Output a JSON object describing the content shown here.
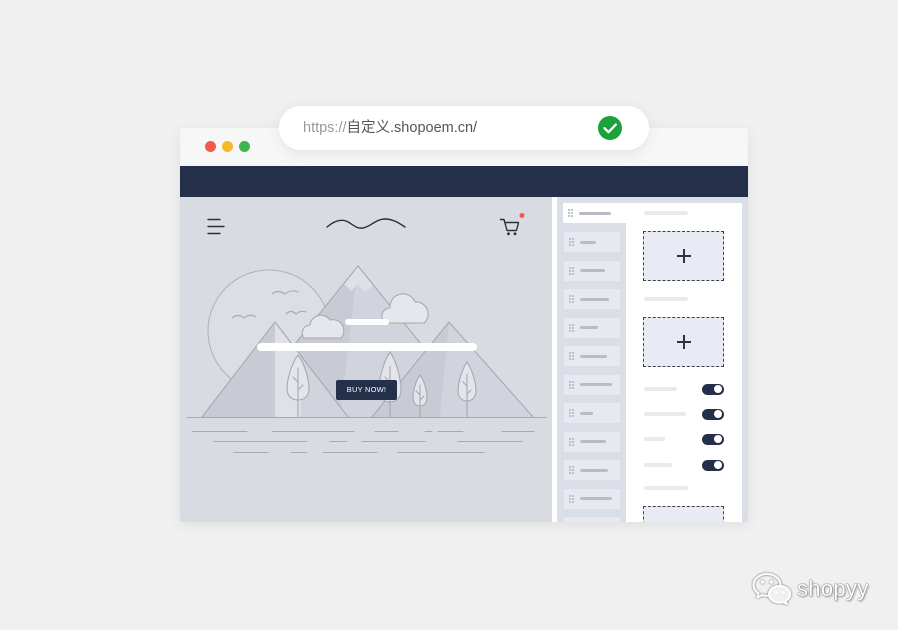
{
  "colors": {
    "page_background": "#f0f0f0",
    "navy": "#243049",
    "success_green": "#1ba23b",
    "close_dot": "#f25a4a",
    "minimize_dot": "#f6b92d",
    "maximize_dot": "#3cb64c",
    "notification_red": "#f25a4a"
  },
  "browser": {
    "window_controls": [
      "close-dot-icon",
      "minimize-dot-icon",
      "maximize-dot-icon"
    ],
    "address_bar": {
      "protocol": "https://",
      "domain": "自定义.shopoem.cn/",
      "status_icon": "check-circle-icon"
    }
  },
  "storefront": {
    "menu_icon": "hamburger-menu-icon",
    "logo_icon": "wave-logo-icon",
    "cart_icon": "shopping-cart-icon",
    "cart_has_notification": true,
    "cta_label": "BUY NOW!"
  },
  "editor": {
    "add_block_icon": "plus-icon",
    "drag_icon": "drag-handle-icon",
    "toggles": [
      true,
      true,
      true,
      true
    ]
  },
  "watermark": {
    "icon": "wechat-icon",
    "text": "shopyy"
  }
}
